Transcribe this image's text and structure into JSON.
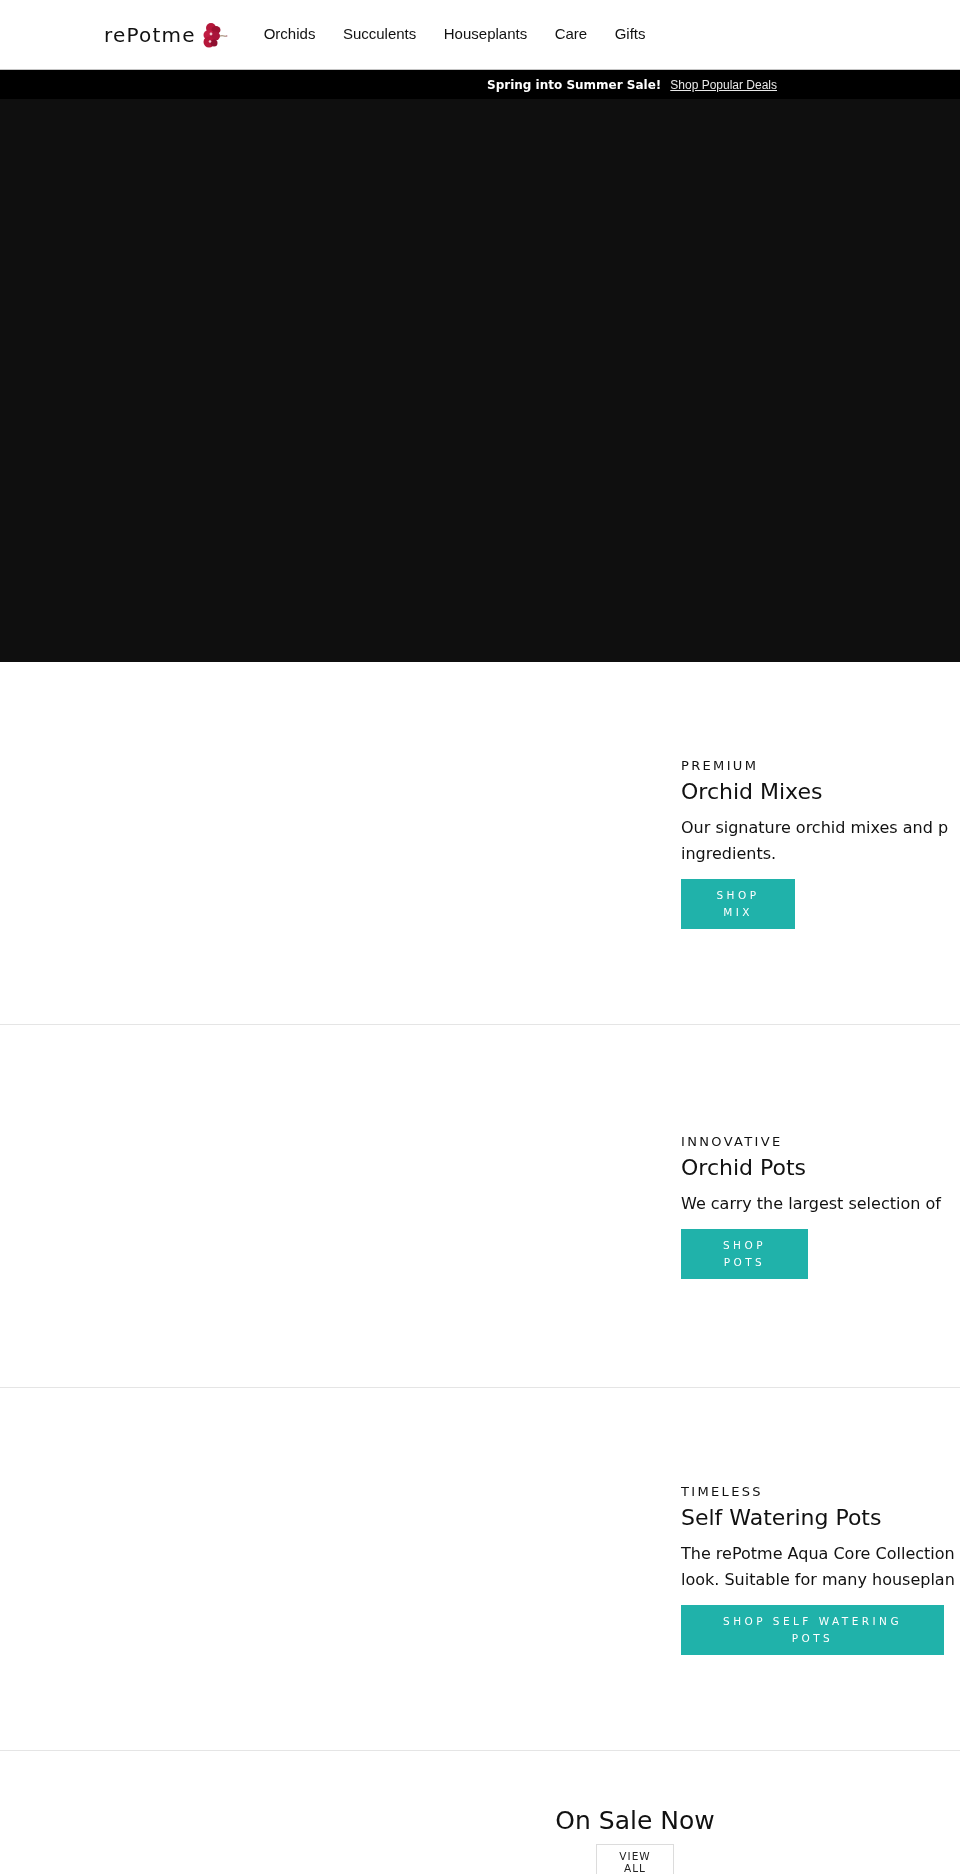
{
  "header": {
    "logo": "rePotme",
    "nav": [
      "Orchids",
      "Succulents",
      "Houseplants",
      "Care",
      "Gifts"
    ]
  },
  "announcement_bar": {
    "text": "Spring into Summer Sale!",
    "link": "Shop Popular Deals"
  },
  "features": [
    {
      "eyebrow": "PREMIUM",
      "title": "Orchid Mixes",
      "description_lines": [
        "Our signature orchid mixes and p",
        "ingredients."
      ],
      "button": "SHOP MIX"
    },
    {
      "eyebrow": "INNOVATIVE",
      "title": "Orchid Pots",
      "description_lines": [
        "We carry the largest selection of"
      ],
      "button": "SHOP POTS"
    },
    {
      "eyebrow": "TIMELESS",
      "title": "Self Watering Pots",
      "description_lines": [
        "The rePotme Aqua Core Collection",
        "look. Suitable for many houseplan"
      ],
      "button": "SHOP SELF WATERING POTS"
    }
  ],
  "on_sale": {
    "title": "On Sale Now",
    "button": "VIEW ALL"
  }
}
